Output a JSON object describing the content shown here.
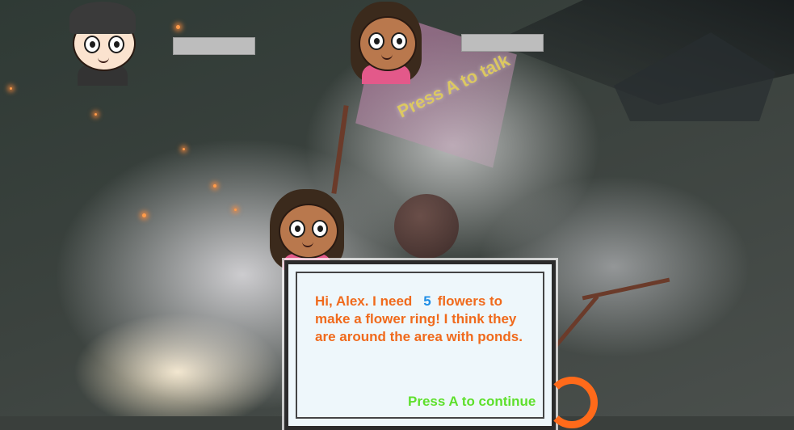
{
  "scene": {
    "world_prompt": "Press A to talk"
  },
  "hud": {
    "player_portrait": {
      "name_label": ""
    },
    "companion_portrait": {
      "name_label": ""
    }
  },
  "dialog": {
    "line_1_before": "Hi, Alex. I need",
    "flower_count": "5",
    "line_1_after": "flowers to make a flower ring! I think they are around the area with ponds.",
    "continue_prompt": "Press A to continue"
  },
  "colors": {
    "dialog_text": "#f06a1c",
    "dialog_number": "#1e8ee6",
    "continue_text": "#5ee02c",
    "ring_indicator": "#ff6a1a"
  }
}
